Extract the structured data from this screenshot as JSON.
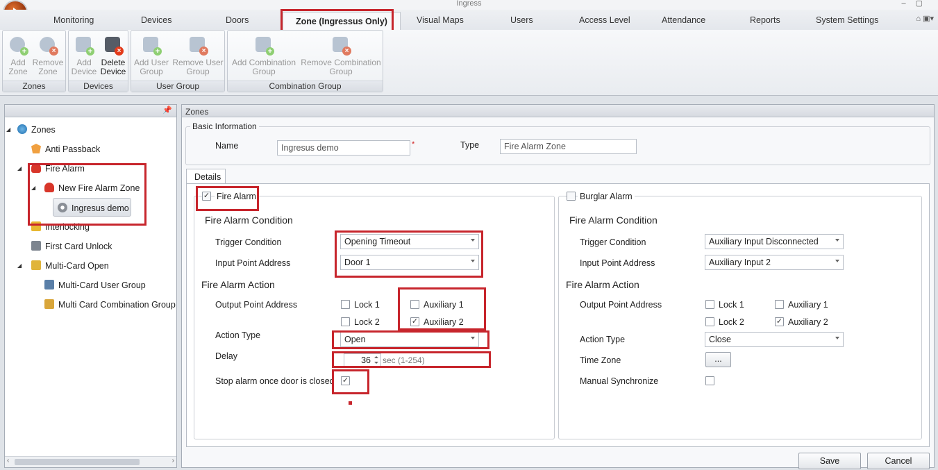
{
  "window": {
    "title": "Ingress"
  },
  "tabs": [
    {
      "label": "Monitoring"
    },
    {
      "label": "Devices"
    },
    {
      "label": "Doors"
    },
    {
      "label": "Zone (Ingressus Only)"
    },
    {
      "label": "Visual Maps"
    },
    {
      "label": "Users"
    },
    {
      "label": "Access Level"
    },
    {
      "label": "Attendance"
    },
    {
      "label": "Reports"
    },
    {
      "label": "System Settings"
    }
  ],
  "ribbon": {
    "zones": {
      "label": "Zones",
      "add_line1": "Add",
      "add_line2": "Zone",
      "remove_line1": "Remove",
      "remove_line2": "Zone"
    },
    "devices": {
      "label": "Devices",
      "add_line1": "Add",
      "add_line2": "Device",
      "delete_line1": "Delete",
      "delete_line2": "Device"
    },
    "user_group": {
      "label": "User Group",
      "add_line1": "Add User",
      "add_line2": "Group",
      "remove_line1": "Remove User",
      "remove_line2": "Group"
    },
    "combination_group": {
      "label": "Combination Group",
      "add_line1": "Add Combination",
      "add_line2": "Group",
      "remove_line1": "Remove Combination",
      "remove_line2": "Group"
    }
  },
  "tree": {
    "root": "Zones",
    "anti_passback": "Anti Passback",
    "fire_alarm": "Fire Alarm",
    "new_fire_alarm_zone": "New Fire Alarm Zone",
    "ingresus_demo": "Ingresus demo",
    "interlocking": "Interlocking",
    "first_card_unlock": "First Card Unlock",
    "multi_card_open": "Multi-Card Open",
    "multi_card_user_group": "Multi-Card User Group",
    "multi_card_combination_group": "Multi Card Combination Group"
  },
  "zones_panel": {
    "header": "Zones",
    "basic_information": "Basic Information",
    "name_label": "Name",
    "name_value": "Ingresus demo",
    "required_mark": "*",
    "type_label": "Type",
    "type_value": "Fire Alarm Zone",
    "details_tab": "Details"
  },
  "fire_alarm": {
    "enable_label": "Fire Alarm",
    "enabled": true,
    "condition_title": "Fire Alarm Condition",
    "trigger_label": "Trigger Condition",
    "trigger_value": "Opening Timeout",
    "input_label": "Input Point Address",
    "input_value": "Door 1",
    "action_title": "Fire Alarm Action",
    "output_label": "Output Point Address",
    "lock1": "Lock 1",
    "lock1_checked": false,
    "lock2": "Lock 2",
    "lock2_checked": false,
    "aux1": "Auxiliary 1",
    "aux1_checked": false,
    "aux2": "Auxiliary 2",
    "aux2_checked": true,
    "action_type_label": "Action Type",
    "action_type_value": "Open",
    "delay_label": "Delay",
    "delay_value": "36",
    "delay_unit": "sec (1-254)",
    "stop_label": "Stop alarm once door is closed",
    "stop_checked": true
  },
  "burglar_alarm": {
    "enable_label": "Burglar Alarm",
    "enabled": false,
    "condition_title": "Fire Alarm Condition",
    "trigger_label": "Trigger Condition",
    "trigger_value": "Auxiliary Input Disconnected",
    "input_label": "Input Point Address",
    "input_value": "Auxiliary Input 2",
    "action_title": "Fire Alarm Action",
    "output_label": "Output Point Address",
    "lock1": "Lock 1",
    "lock1_checked": false,
    "lock2": "Lock 2",
    "lock2_checked": false,
    "aux1": "Auxiliary 1",
    "aux1_checked": false,
    "aux2": "Auxiliary 2",
    "aux2_checked": true,
    "action_type_label": "Action Type",
    "action_type_value": "Close",
    "time_zone_label": "Time Zone",
    "time_zone_button": "...",
    "manual_sync_label": "Manual Synchronize",
    "manual_sync_checked": false
  },
  "footer": {
    "save": "Save",
    "cancel": "Cancel"
  },
  "colors": {
    "highlight": "#c7252c",
    "accent": "#d05a1a"
  }
}
